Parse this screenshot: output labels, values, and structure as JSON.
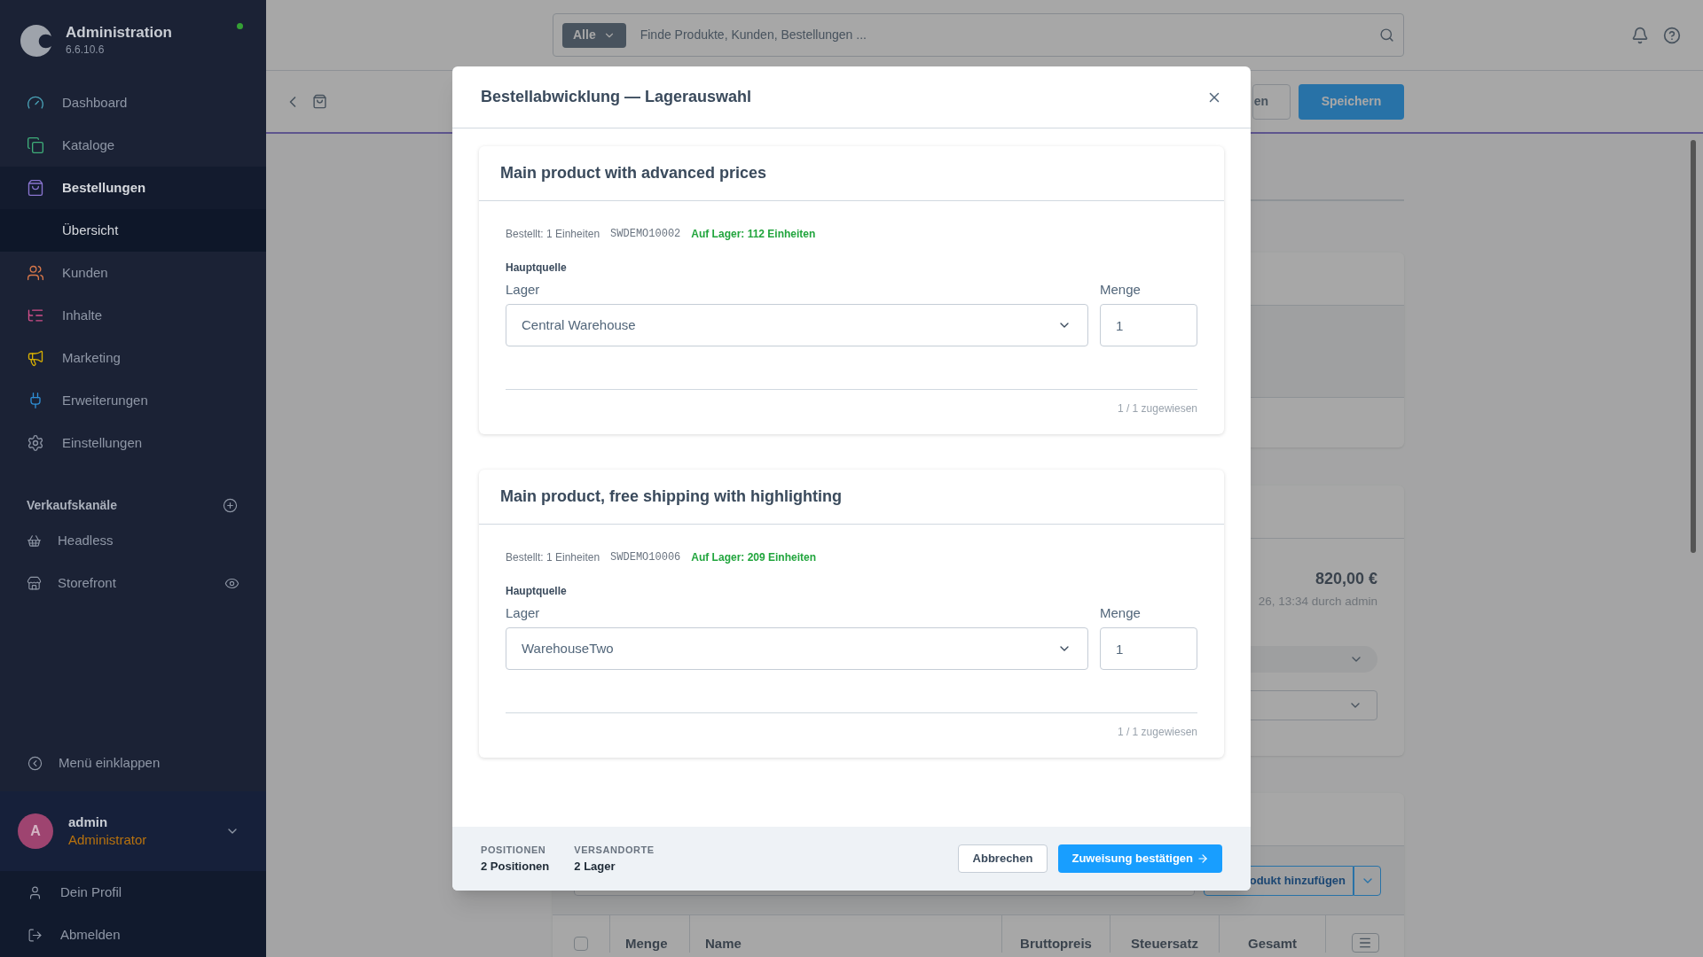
{
  "sidebar": {
    "app_title": "Administration",
    "version": "6.6.10.6",
    "nav_items": [
      {
        "label": "Dashboard",
        "selected": false
      },
      {
        "label": "Kataloge",
        "selected": false
      },
      {
        "label": "Bestellungen",
        "selected": true,
        "children": [
          {
            "label": "Übersicht",
            "selected": true
          }
        ]
      },
      {
        "label": "Kunden",
        "selected": false
      },
      {
        "label": "Inhalte",
        "selected": false
      },
      {
        "label": "Marketing",
        "selected": false
      },
      {
        "label": "Erweiterungen",
        "selected": false
      },
      {
        "label": "Einstellungen",
        "selected": false
      }
    ],
    "sales_channels": {
      "title": "Verkaufskanäle",
      "items": [
        {
          "label": "Headless"
        },
        {
          "label": "Storefront"
        }
      ]
    },
    "collapse_label": "Menü einklappen",
    "user": {
      "initial": "A",
      "name": "admin",
      "role": "Administrator"
    },
    "user_menu": [
      "Dein Profil",
      "Abmelden"
    ]
  },
  "header": {
    "search": {
      "scope": "Alle",
      "placeholder": "Finde Produkte, Kunden, Bestellungen ..."
    }
  },
  "toolbar": {
    "buttons": [
      "en",
      "Speichern"
    ]
  },
  "background": {
    "order_total": "820,00 €",
    "last_change": "26, 13:34 durch admin",
    "add_button": "odukt hinzufügen",
    "table_columns": [
      "Menge",
      "Name",
      "Bruttopreis",
      "Steuersatz",
      "Gesamt"
    ],
    "select_all_checked": false
  },
  "modal": {
    "title": "Bestellabwicklung — Lagerauswahl",
    "items": [
      {
        "title": "Main product with advanced prices",
        "ordered": "Bestellt: 1 Einheiten",
        "sku": "SWDEMO10002",
        "stock": "Auf Lager: 112 Einheiten",
        "source_label": "Hauptquelle",
        "warehouse_label": "Lager",
        "warehouse": "Central Warehouse",
        "quantity_label": "Menge",
        "quantity": "1",
        "assigned": "1 / 1 zugewiesen"
      },
      {
        "title": "Main product, free shipping with highlighting",
        "ordered": "Bestellt: 1 Einheiten",
        "sku": "SWDEMO10006",
        "stock": "Auf Lager: 209 Einheiten",
        "source_label": "Hauptquelle",
        "warehouse_label": "Lager",
        "warehouse": "WarehouseTwo",
        "quantity_label": "Menge",
        "quantity": "1",
        "assigned": "1 / 1 zugewiesen"
      }
    ],
    "footer": {
      "stats": [
        {
          "label": "POSITIONEN",
          "value": "2 Positionen"
        },
        {
          "label": "VERSANDORTE",
          "value": "2 Lager"
        }
      ],
      "cancel": "Abbrechen",
      "confirm": "Zuweisung bestätigen"
    }
  }
}
